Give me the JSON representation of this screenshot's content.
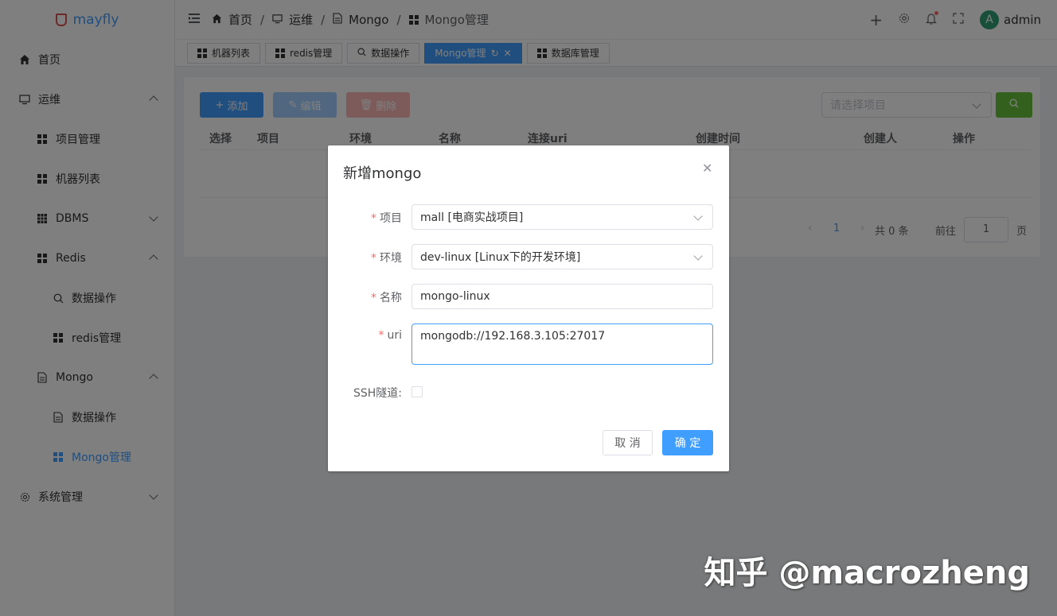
{
  "app": {
    "logo_text": "mayfly",
    "brand_color": "#409eff"
  },
  "sidebar": {
    "items": [
      {
        "label": "首页",
        "icon": "home-icon"
      },
      {
        "label": "运维",
        "icon": "monitor-icon"
      },
      {
        "label": "项目管理",
        "icon": "grid-icon"
      },
      {
        "label": "机器列表",
        "icon": "grid-icon"
      },
      {
        "label": "DBMS",
        "icon": "table-icon"
      },
      {
        "label": "Redis",
        "icon": "grid-icon"
      },
      {
        "label": "数据操作",
        "icon": "search-icon"
      },
      {
        "label": "redis管理",
        "icon": "grid-icon"
      },
      {
        "label": "Mongo",
        "icon": "document-icon"
      },
      {
        "label": "数据操作",
        "icon": "document-icon"
      },
      {
        "label": "Mongo管理",
        "icon": "grid-icon"
      },
      {
        "label": "系统管理",
        "icon": "gear-icon"
      }
    ]
  },
  "breadcrumb": {
    "items": [
      "首页",
      "运维",
      "Mongo",
      "Mongo管理"
    ],
    "sep": "/"
  },
  "header": {
    "user": "admin",
    "avatar_letter": "A"
  },
  "tags": {
    "items": [
      "机器列表",
      "redis管理",
      "数据操作",
      "Mongo管理",
      "数据库管理"
    ],
    "active": "Mongo管理"
  },
  "toolbar": {
    "add": "添加",
    "edit": "编辑",
    "delete": "删除",
    "project_placeholder": "请选择项目"
  },
  "table": {
    "columns": [
      "选择",
      "项目",
      "环境",
      "名称",
      "连接uri",
      "创建时间",
      "创建人",
      "操作"
    ]
  },
  "pagination": {
    "current": "1",
    "total": "共 0 条",
    "goto_label": "前往",
    "goto_value": "1",
    "page_suffix": "页"
  },
  "modal": {
    "title": "新增mongo",
    "fields": {
      "project": {
        "label": "项目",
        "value": "mall [电商实战项目]"
      },
      "env": {
        "label": "环境",
        "value": "dev-linux [Linux下的开发环境]"
      },
      "name": {
        "label": "名称",
        "value": "mongo-linux"
      },
      "uri": {
        "label": "uri",
        "value": "mongodb://192.168.3.105:27017"
      },
      "ssh": {
        "label": "SSH隧道:"
      }
    },
    "cancel": "取 消",
    "confirm": "确 定"
  },
  "watermark": "知乎 @macrozheng"
}
